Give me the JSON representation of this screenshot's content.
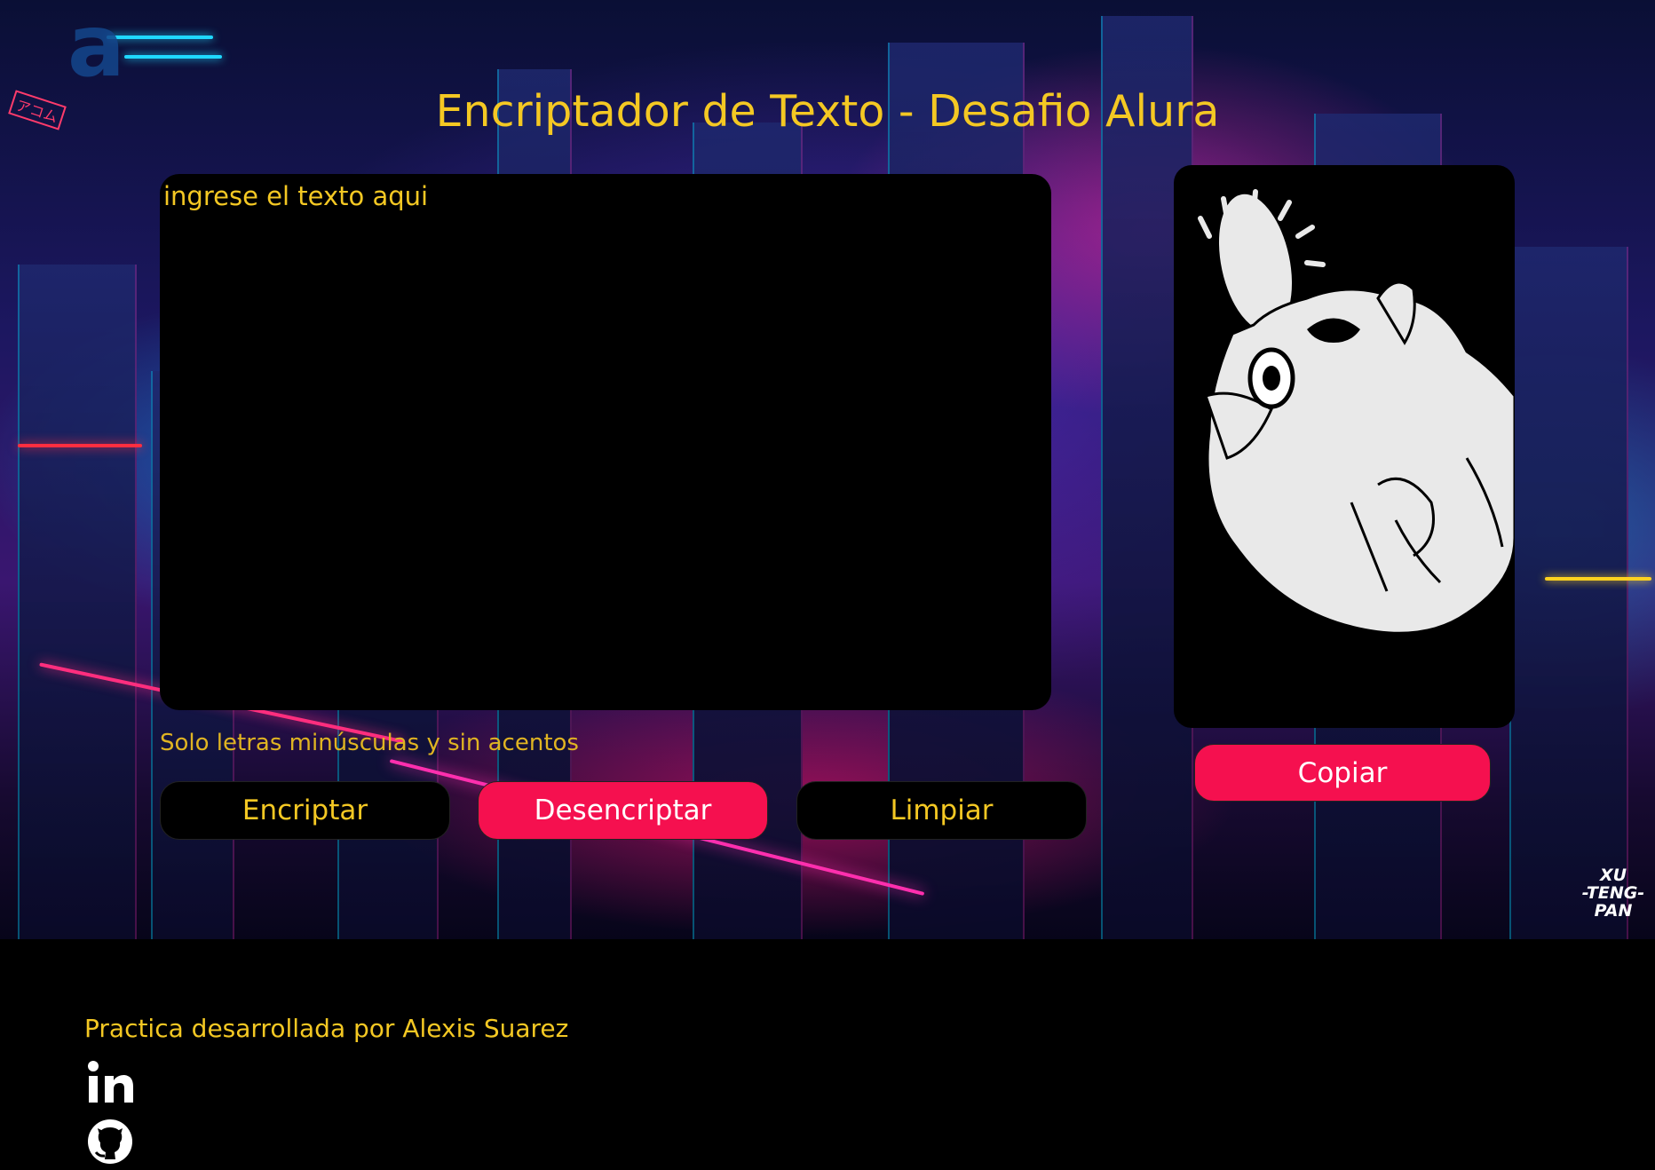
{
  "header": {
    "title": "Encriptador de Texto - Desafio Alura"
  },
  "input": {
    "placeholder": "ingrese el texto aqui",
    "value": ""
  },
  "hint": "Solo letras minúsculas y sin acentos",
  "buttons": {
    "encrypt": "Encriptar",
    "decrypt": "Desencriptar",
    "clear": "Limpiar",
    "copy": "Copiar"
  },
  "background": {
    "sign_text": "アコム",
    "watermark": "XU\n-TENG-\nPAN"
  },
  "footer": {
    "credit": "Practica desarrollada por Alexis Suarez",
    "links": [
      {
        "icon": "linkedin-icon"
      },
      {
        "icon": "github-icon"
      }
    ]
  },
  "colors": {
    "accent_yellow": "#f4c823",
    "accent_pink": "#f5104f",
    "panel": "#000000"
  }
}
